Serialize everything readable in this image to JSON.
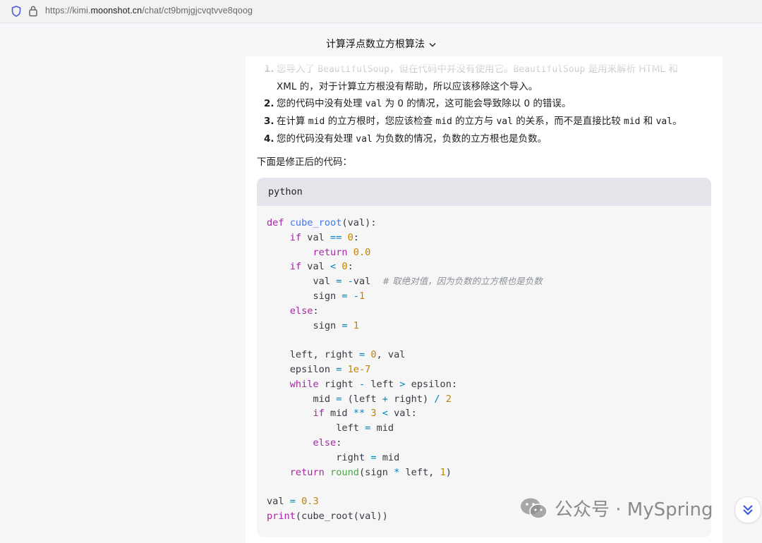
{
  "browser": {
    "url_prefix": "https://kimi.",
    "url_domain": "moonshot.cn",
    "url_path": "/chat/ct9bmjgjcvqtvve8qoog"
  },
  "chat": {
    "title": "计算浮点数立方根算法"
  },
  "message": {
    "items": [
      {
        "num": "1.",
        "parts": [
          "您导入了 ",
          "BeautifulSoup",
          "，但在代码中并没有使用它。",
          "BeautifulSoup",
          " 是用来解析 HTML 和"
        ],
        "line2": "XML 的，对于计算立方根没有帮助，所以应该移除这个导入。"
      },
      {
        "num": "2.",
        "parts": [
          "您的代码中没有处理 ",
          "val",
          " 为 0 的情况，这可能会导致除以 0 的错误。"
        ]
      },
      {
        "num": "3.",
        "parts": [
          "在计算 ",
          "mid",
          " 的立方根时，您应该检查 ",
          "mid",
          " 的立方与 ",
          "val",
          " 的关系，而不是直接比较 ",
          "mid",
          " 和 ",
          "val",
          "。"
        ]
      },
      {
        "num": "4.",
        "parts": [
          "您的代码没有处理 ",
          "val",
          " 为负数的情况，负数的立方根也是负数。"
        ]
      }
    ],
    "intro": "下面是修正后的代码："
  },
  "code": {
    "language": "python",
    "comment": "# 取绝对值，因为负数的立方根也是负数"
  },
  "watermark": {
    "text": "公众号 · MySpring"
  },
  "colors": {
    "keyword": "#a626a4",
    "function": "#4078f2",
    "number": "#c18401",
    "operator": "#0184bc",
    "builtin": "#50a14f"
  },
  "icons": [
    "shield-icon",
    "lock-icon",
    "chevron-down-icon",
    "wechat-icon",
    "scroll-down-icon"
  ]
}
